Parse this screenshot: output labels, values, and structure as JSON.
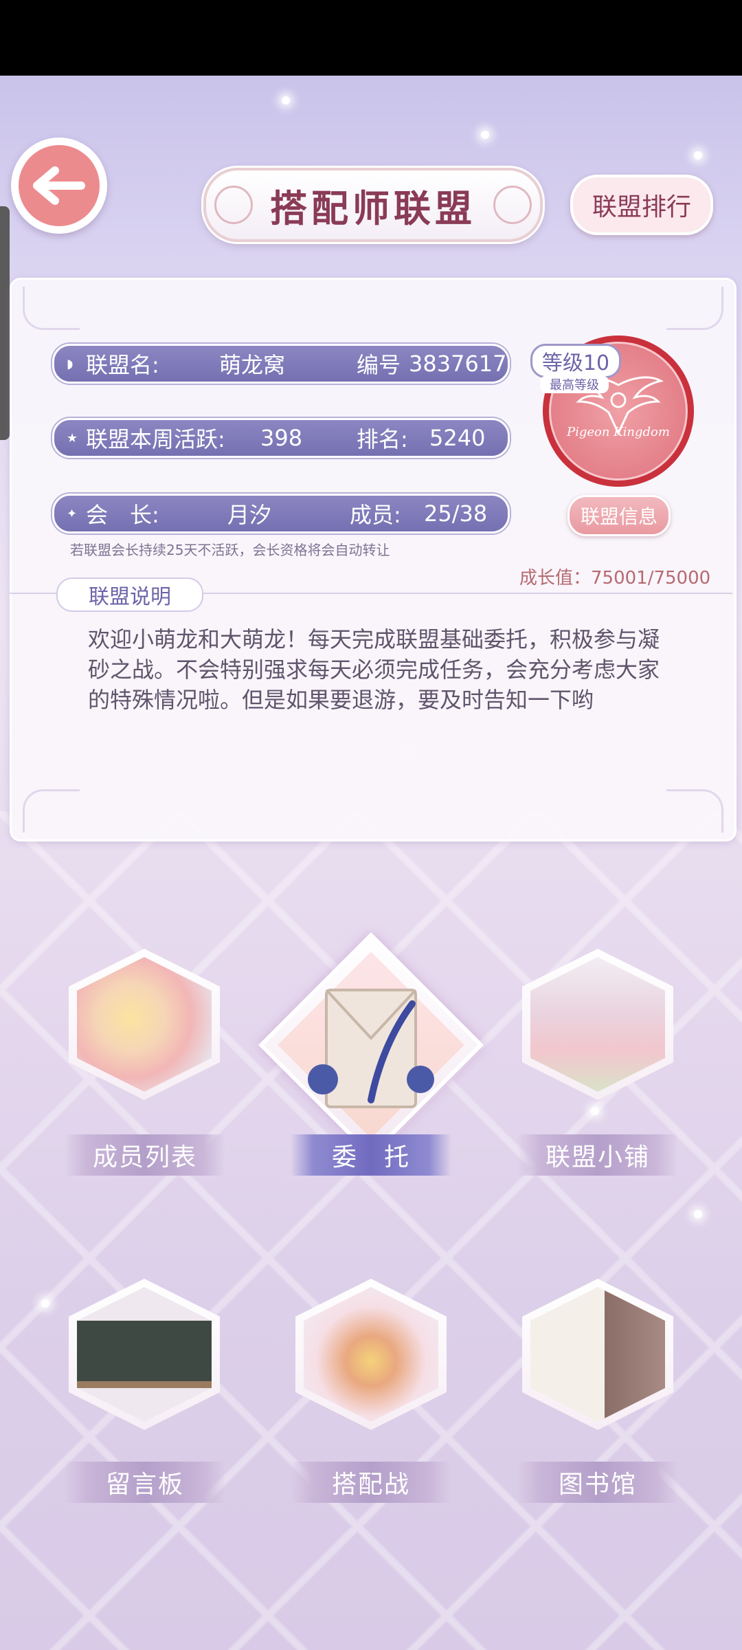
{
  "header": {
    "title": "搭配师联盟",
    "ranking_button": "联盟排行"
  },
  "alliance": {
    "name_label": "联盟名:",
    "name": "萌龙窝",
    "id_label": "编号",
    "id": "3837617",
    "activity_label": "联盟本周活跃:",
    "activity": "398",
    "rank_label": "排名:",
    "rank": "5240",
    "leader_label": "会　长:",
    "leader": "月汐",
    "members_label": "成员:",
    "members": "25/38",
    "level": "等级10",
    "max_level": "最高等级",
    "emblem_text": "Pigeon Kingdom",
    "info_button": "联盟信息",
    "transfer_note": "若联盟会长持续25天不活跃，会长资格将会自动转让",
    "growth": "成长值：75001/75000",
    "description_tab": "联盟说明",
    "description": "欢迎小萌龙和大萌龙！每天完成联盟基础委托，积极参与凝砂之战。不会特别强求每天必须完成任务，会充分考虑大家的特殊情况啦。但是如果要退游，要及时告知一下哟"
  },
  "tiles": [
    {
      "label": "成员列表",
      "icon": "members-icon"
    },
    {
      "label": "委　托",
      "icon": "commission-icon"
    },
    {
      "label": "联盟小铺",
      "icon": "shop-icon"
    },
    {
      "label": "留言板",
      "icon": "message-board-icon"
    },
    {
      "label": "搭配战",
      "icon": "battle-icon"
    },
    {
      "label": "图书馆",
      "icon": "library-icon"
    }
  ],
  "colors": {
    "accent": "#7570b1",
    "title": "#8a3b56",
    "back_button": "#ec8b8e"
  }
}
